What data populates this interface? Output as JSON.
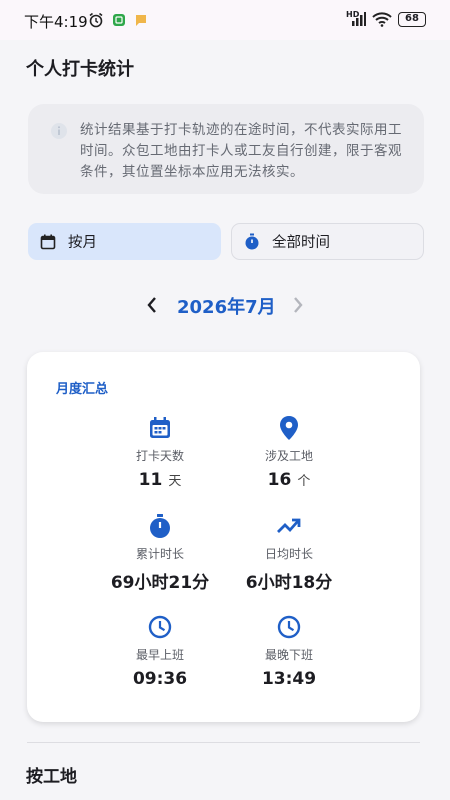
{
  "status_bar": {
    "time": "下午4:19",
    "battery": "68",
    "network": "HD"
  },
  "page": {
    "title": "个人打卡统计"
  },
  "notice": {
    "text": "统计结果基于打卡轨迹的在途时间，不代表实际用工时间。众包工地由打卡人或工友自行创建，限于客观条件，其位置坐标本应用无法核实。",
    "icon": "info-icon"
  },
  "filters": {
    "by_month": "按月",
    "all_time": "全部时间"
  },
  "month_nav": {
    "label": "2026年7月"
  },
  "summary": {
    "title": "月度汇总",
    "stats": [
      {
        "label": "打卡天数",
        "value": "11",
        "unit": "天",
        "icon": "calendar-icon"
      },
      {
        "label": "涉及工地",
        "value": "16",
        "unit": "个",
        "icon": "location-pin-icon"
      },
      {
        "label": "累计时长",
        "value": "69小时21分",
        "unit": "",
        "icon": "stopwatch-icon"
      },
      {
        "label": "日均时长",
        "value": "6小时18分",
        "unit": "",
        "icon": "trending-up-icon"
      },
      {
        "label": "最早上班",
        "value": "09:36",
        "unit": "",
        "icon": "clock-icon"
      },
      {
        "label": "最晚下班",
        "value": "13:49",
        "unit": "",
        "icon": "clock-icon"
      }
    ]
  },
  "section": {
    "by_site": "按工地"
  },
  "colors": {
    "accent": "#1f5fc7",
    "selected_bg": "#d9e6fb",
    "notice_bg": "#ececf0"
  }
}
